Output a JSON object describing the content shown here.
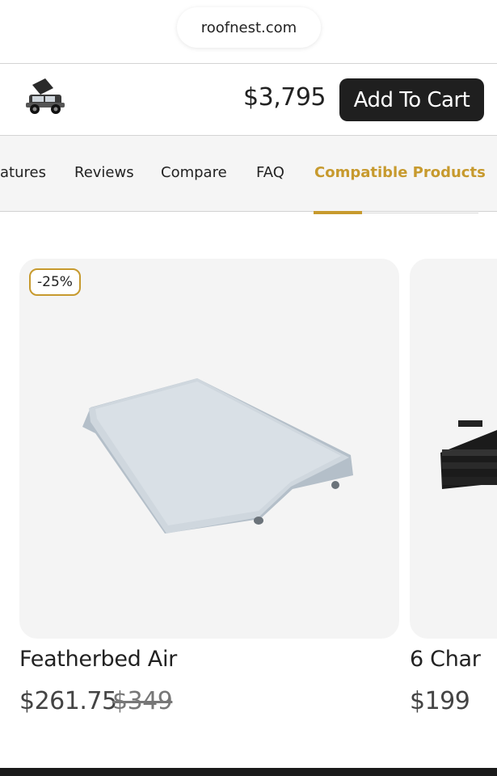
{
  "browser": {
    "url": "roofnest.com"
  },
  "sticky_bar": {
    "thumbnail_icon": "rooftop-tent-vehicle-thumbnail",
    "price": "$3,795",
    "add_to_cart_label": "Add To Cart"
  },
  "tabs": {
    "items": [
      {
        "label": "atures"
      },
      {
        "label": "Reviews"
      },
      {
        "label": "Compare"
      },
      {
        "label": "FAQ"
      },
      {
        "label": "Compatible Products",
        "active": true
      }
    ]
  },
  "products": [
    {
      "badge": "-25%",
      "name": "Featherbed Air",
      "price": "$261.75",
      "old_price": "$349",
      "image": "inflatable-mattress-image"
    },
    {
      "name": "6 Char",
      "price": "$199",
      "image": "chair-image"
    }
  ],
  "colors": {
    "accent": "#c79a2e",
    "button_bg": "#1f1f1f",
    "card_bg": "#f4f4f4"
  }
}
